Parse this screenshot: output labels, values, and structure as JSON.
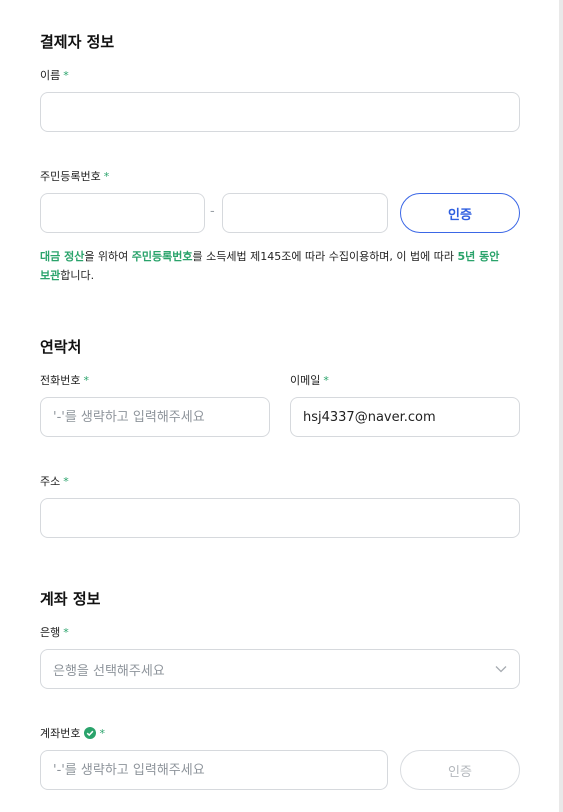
{
  "payer": {
    "title": "결제자 정보",
    "name_label": "이름",
    "name_value": "",
    "rrn_label": "주민등록번호",
    "rrn_front_value": "",
    "rrn_back_value": "",
    "rrn_dash": "-",
    "verify_label": "인증",
    "notice": {
      "p1": "대금 정산",
      "p2": "을 위하여 ",
      "p3": "주민등록번호",
      "p4": "를 소득세법 제145조에 따라 수집이용하며, 이 법에 따라 ",
      "p5": "5년 동안",
      "p6": "보관",
      "p7": "합니다."
    }
  },
  "contact": {
    "title": "연락처",
    "phone_label": "전화번호",
    "phone_placeholder": "'-'를 생략하고 입력해주세요",
    "email_label": "이메일",
    "email_value": "hsj4337@naver.com",
    "address_label": "주소",
    "address_value": ""
  },
  "account": {
    "title": "계좌 정보",
    "bank_label": "은행",
    "bank_placeholder": "은행을 선택해주세요",
    "number_label": "계좌번호",
    "number_placeholder": "'-'를 생략하고 입력해주세요",
    "verify_label": "인증"
  },
  "required_mark": "*",
  "colors": {
    "accent_green": "#2aa36b",
    "accent_blue": "#2f5fe0",
    "border": "#d6d9dd",
    "placeholder": "#8e949b"
  },
  "icons": {
    "check": "check-circle-icon",
    "chevron": "chevron-down-icon"
  }
}
